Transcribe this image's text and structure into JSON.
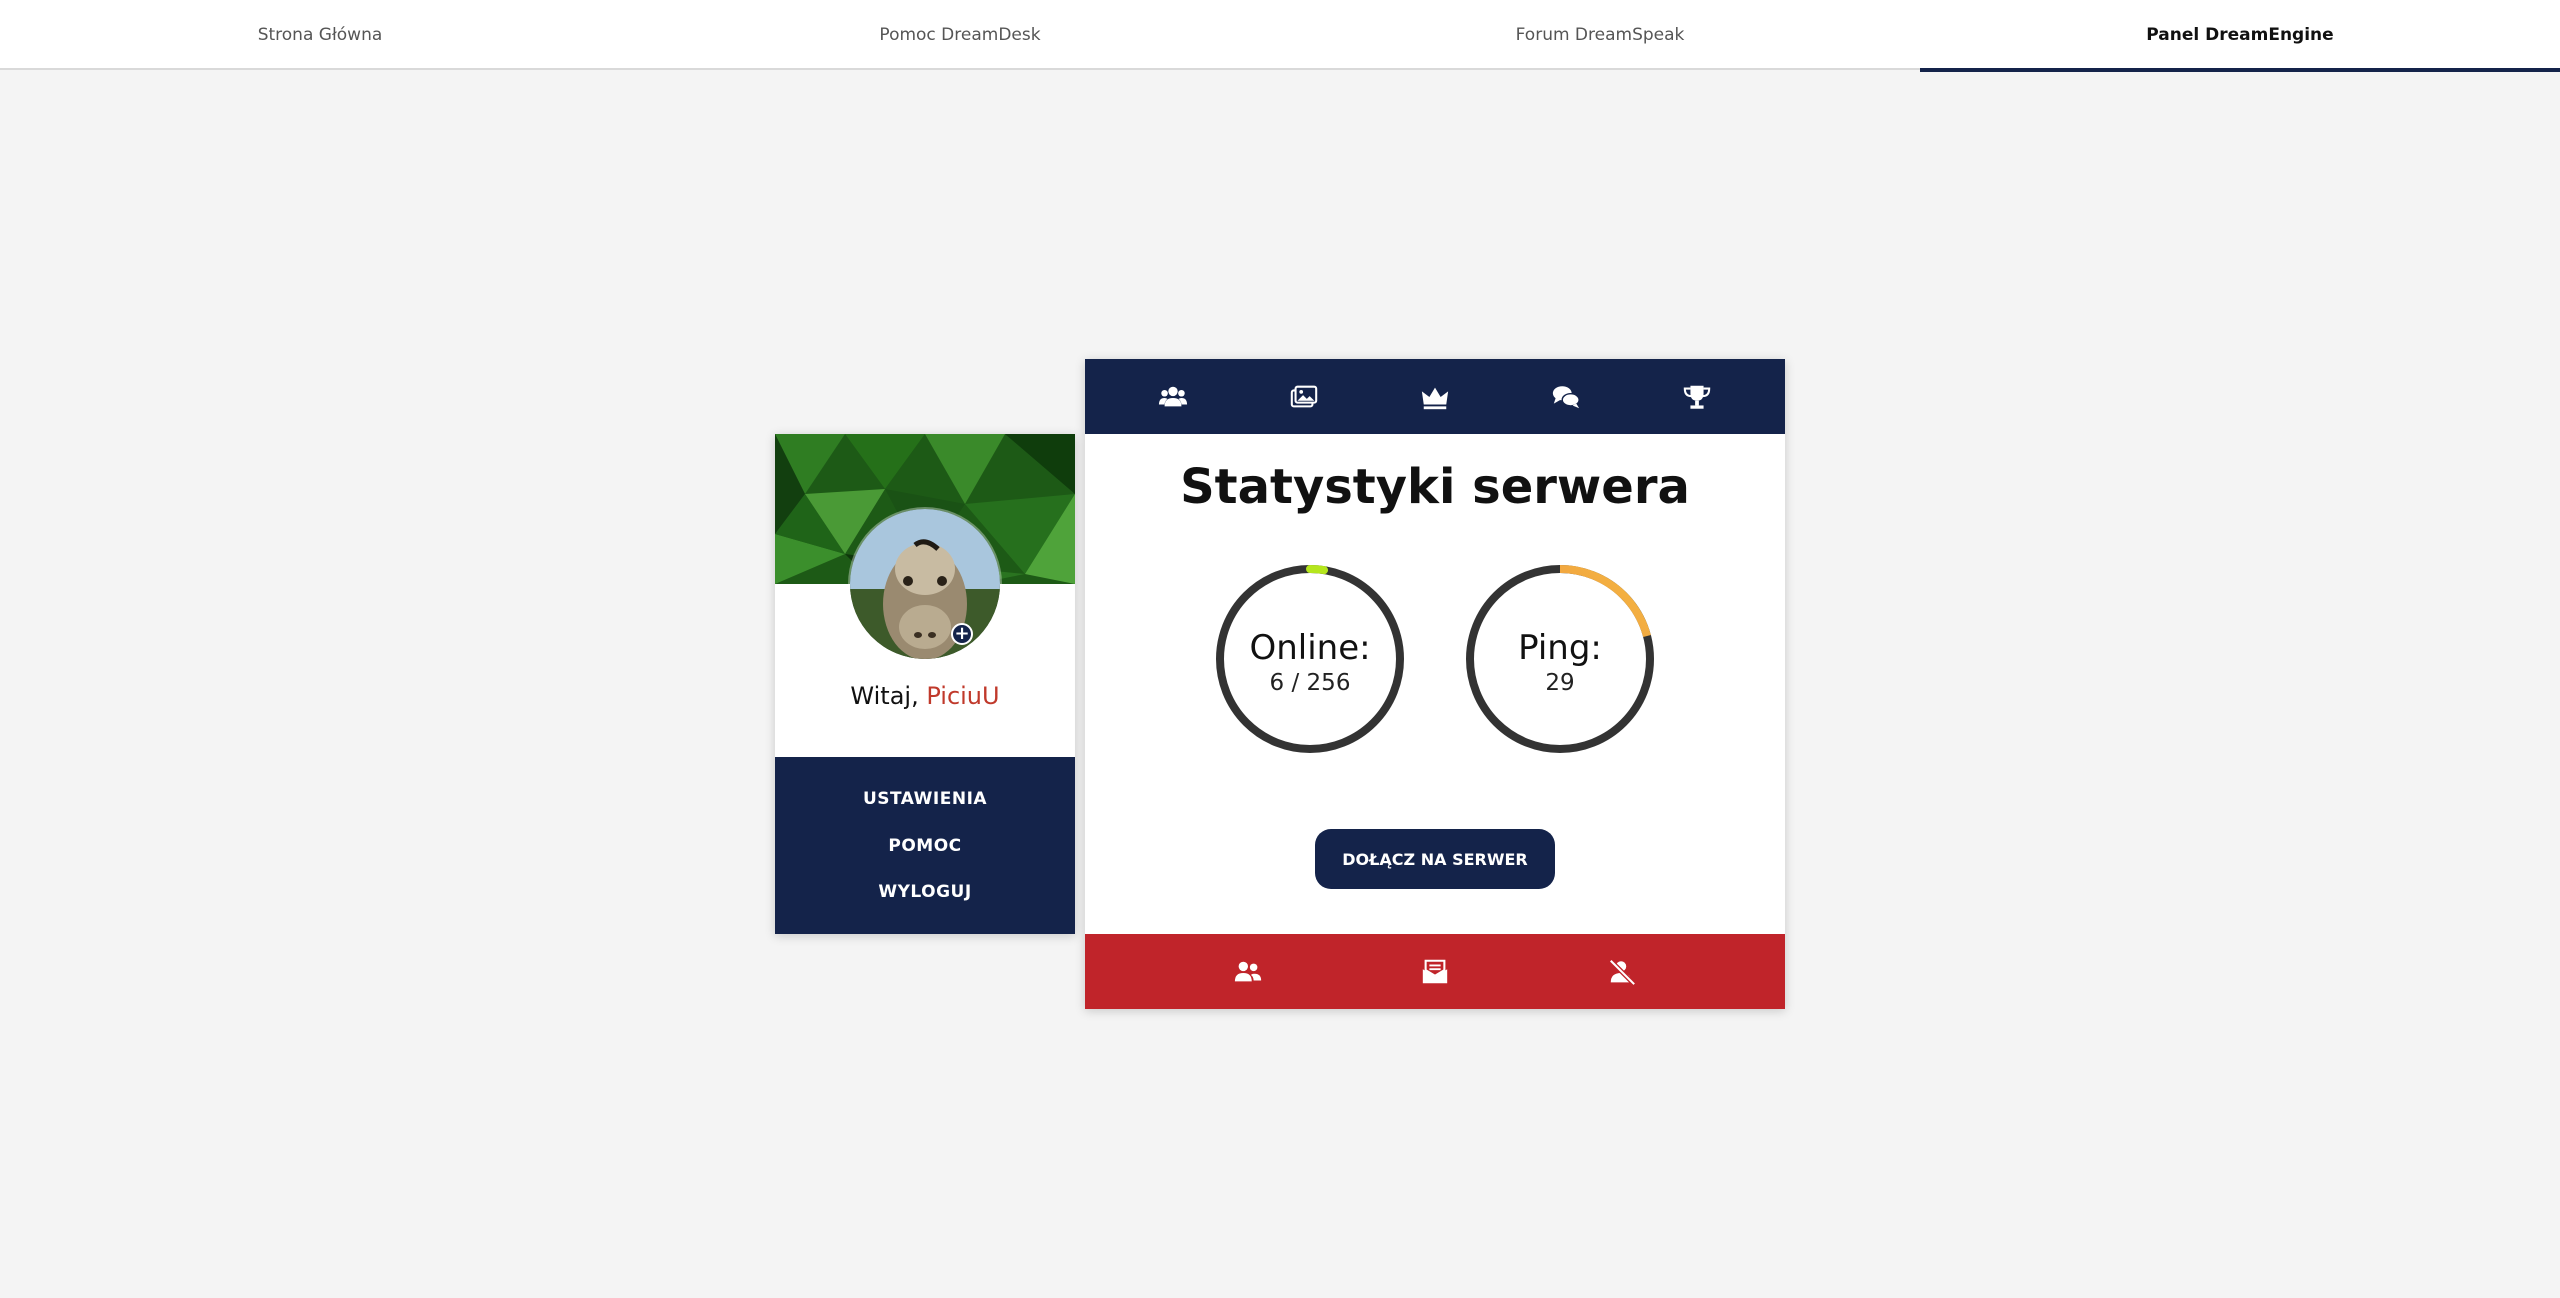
{
  "nav": {
    "tabs": [
      {
        "label": "Strona Główna"
      },
      {
        "label": "Pomoc DreamDesk"
      },
      {
        "label": "Forum DreamSpeak"
      },
      {
        "label": "Panel DreamEngine",
        "active": true
      }
    ]
  },
  "profile": {
    "greeting_prefix": "Witaj, ",
    "username": "PiciuU",
    "menu": [
      {
        "label": "USTAWIENIA"
      },
      {
        "label": "POMOC"
      },
      {
        "label": "WYLOGUJ"
      }
    ]
  },
  "panel": {
    "top_icons": [
      "users-icon",
      "images-icon",
      "crown-icon",
      "comments-icon",
      "trophy-icon"
    ],
    "title": "Statystyki serwera",
    "online": {
      "label": "Online:",
      "value_text": "6 / 256",
      "current": 6,
      "max": 256
    },
    "ping": {
      "label": "Ping:",
      "value_text": "29",
      "value": 29
    },
    "join_button": "DOŁĄCZ NA SERWER",
    "bottom_icons": [
      "user-friends-icon",
      "mail-box-icon",
      "user-slash-icon"
    ]
  },
  "colors": {
    "navy": "#14234a",
    "red": "#c0242a",
    "username": "#c0392b",
    "online_gauge": "#b5e61d",
    "ping_gauge_start": "#e8743b",
    "ping_gauge_end": "#f5b942"
  }
}
